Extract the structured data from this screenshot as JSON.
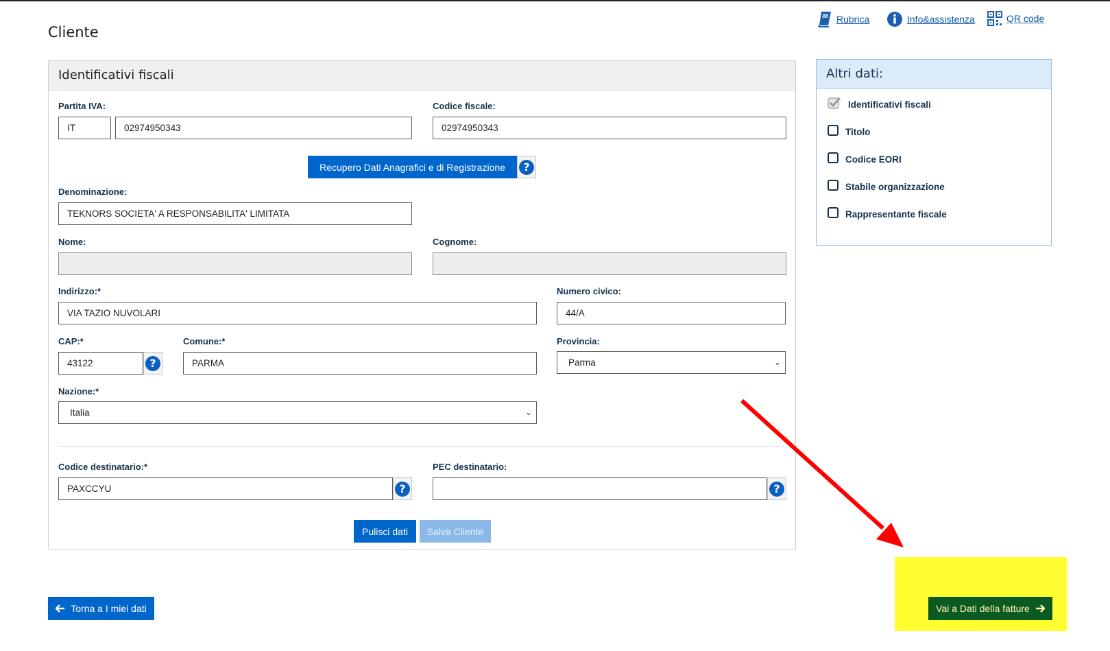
{
  "page": {
    "title": "Cliente"
  },
  "top_links": {
    "rubrica": "Rubrica",
    "info": "Info&assistenza",
    "qr": "QR code"
  },
  "panel": {
    "title": "Identificativi fiscali",
    "partita_iva": {
      "label": "Partita IVA:",
      "country": "IT",
      "value": "02974950343"
    },
    "codice_fiscale": {
      "label": "Codice fiscale:",
      "value": "02974950343"
    },
    "recupero_button": "Recupero Dati Anagrafici e di Registrazione",
    "denominazione": {
      "label": "Denominazione:",
      "value": "TEKNORS SOCIETA' A RESPONSABILITA' LIMITATA"
    },
    "nome": {
      "label": "Nome:",
      "value": ""
    },
    "cognome": {
      "label": "Cognome:",
      "value": ""
    },
    "indirizzo": {
      "label": "Indirizzo:*",
      "value": "VIA TAZIO NUVOLARI"
    },
    "numero_civico": {
      "label": "Numero civico:",
      "value": "44/A"
    },
    "cap": {
      "label": "CAP:*",
      "value": "43122"
    },
    "comune": {
      "label": "Comune:*",
      "value": "PARMA"
    },
    "provincia": {
      "label": "Provincia:",
      "value": "Parma"
    },
    "nazione": {
      "label": "Nazione:*",
      "value": "Italia"
    },
    "codice_destinatario": {
      "label": "Codice destinatario:*",
      "value": "PAXCCYU"
    },
    "pec_destinatario": {
      "label": "PEC destinatario:",
      "value": ""
    },
    "pulisci_button": "Pulisci dati",
    "salva_button": "Salva Cliente"
  },
  "side": {
    "title": "Altri dati:",
    "items": [
      {
        "label": "Identificativi fiscali",
        "checked": true
      },
      {
        "label": "Titolo",
        "checked": false
      },
      {
        "label": "Codice EORI",
        "checked": false
      },
      {
        "label": "Stabile organizzazione",
        "checked": false
      },
      {
        "label": "Rappresentante fiscale",
        "checked": false
      }
    ]
  },
  "footer": {
    "back_button": "Torna a I miei dati",
    "next_button": "Vai a Dati della fatture"
  },
  "colors": {
    "primary": "#0066cc",
    "next": "#0b5a23",
    "highlight": "#ffff30",
    "arrow": "#ff0000"
  }
}
